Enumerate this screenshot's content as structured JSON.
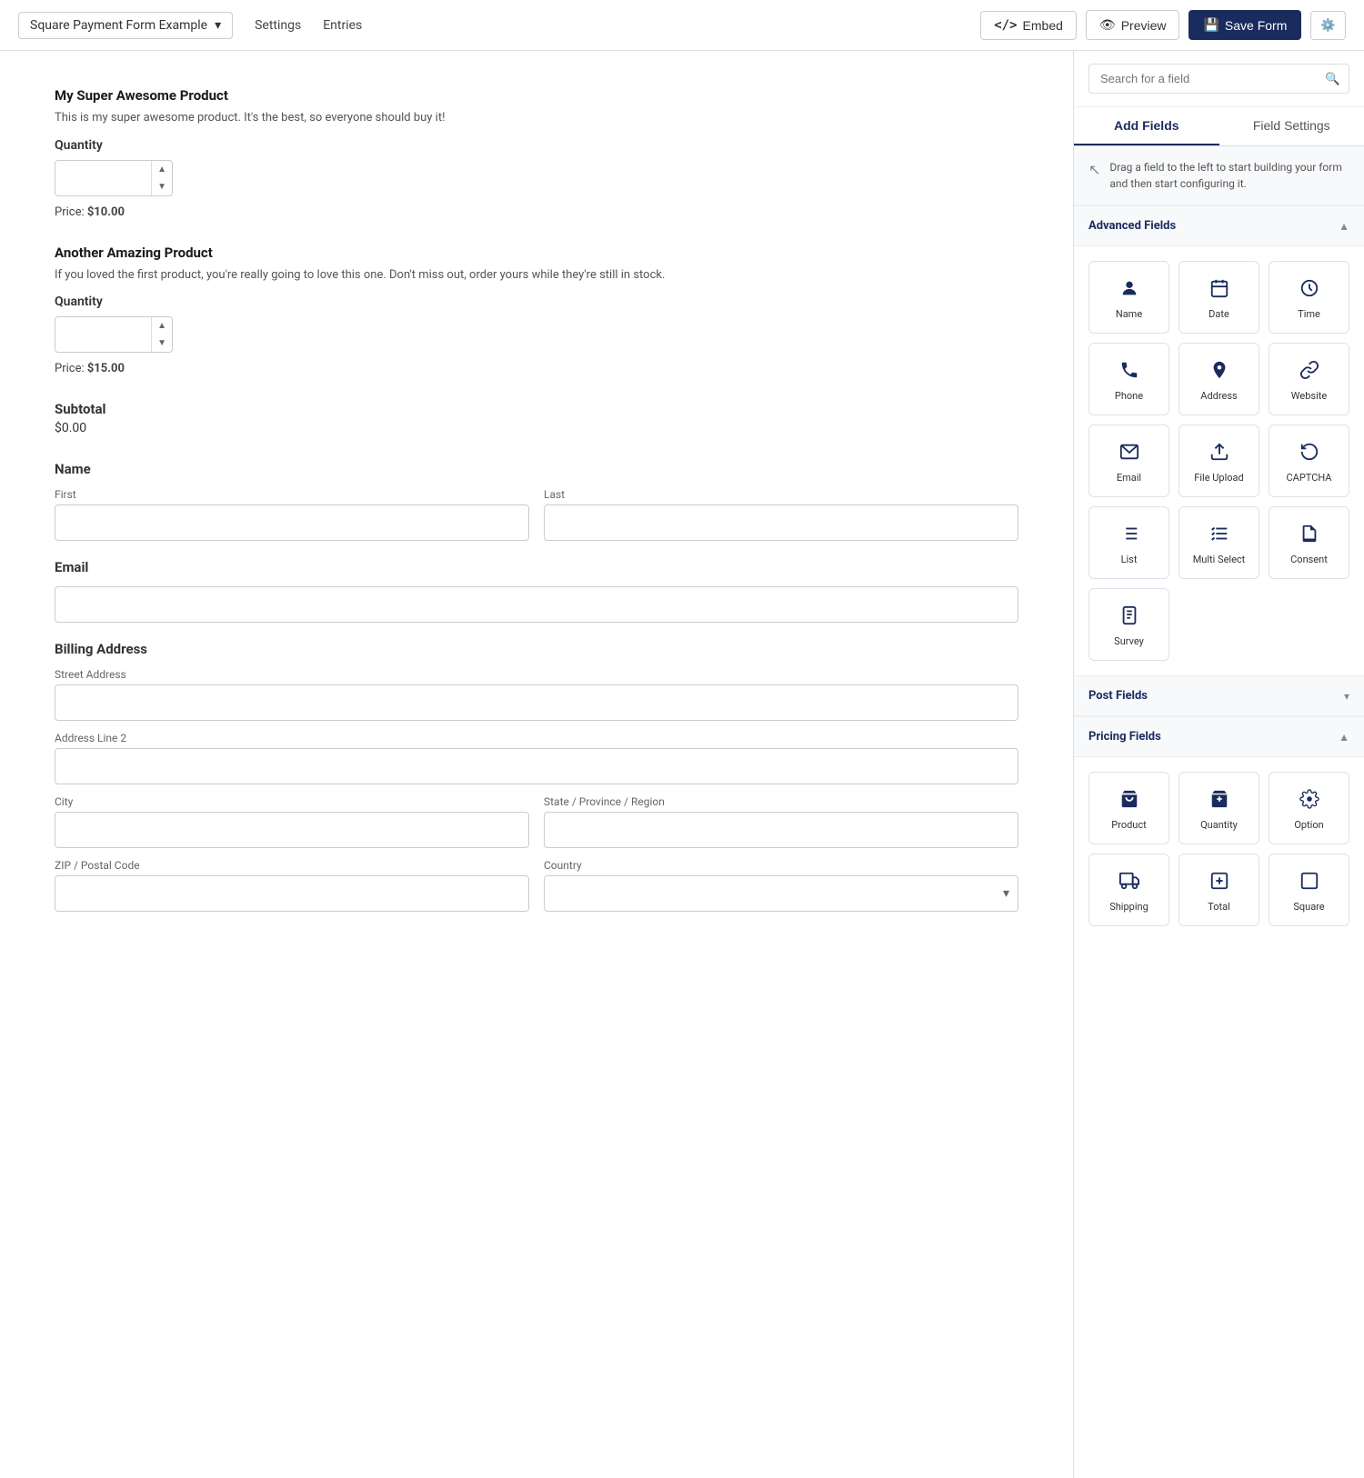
{
  "topNav": {
    "formSelector": "Square Payment Form Example",
    "settingsLink": "Settings",
    "entriesLink": "Entries",
    "embedLabel": "Embed",
    "previewLabel": "Preview",
    "saveLabel": "Save Form"
  },
  "formArea": {
    "product1": {
      "name": "My Super Awesome Product",
      "description": "This is my super awesome product. It's the best, so everyone should buy it!",
      "quantityLabel": "Quantity",
      "price": "$10.00"
    },
    "product2": {
      "name": "Another Amazing Product",
      "description": "If you loved the first product, you're really going to love this one. Don't miss out, order yours while they're still in stock.",
      "quantityLabel": "Quantity",
      "price": "$15.00"
    },
    "subtotal": {
      "title": "Subtotal",
      "value": "$0.00"
    },
    "nameSection": {
      "label": "Name",
      "firstLabel": "First",
      "lastLabel": "Last",
      "firstPlaceholder": "",
      "lastPlaceholder": ""
    },
    "emailSection": {
      "label": "Email",
      "placeholder": ""
    },
    "billingSection": {
      "label": "Billing Address",
      "streetLabel": "Street Address",
      "addressLine2Label": "Address Line 2",
      "cityLabel": "City",
      "stateLabel": "State / Province / Region",
      "zipLabel": "ZIP / Postal Code",
      "countryLabel": "Country",
      "countryPlaceholder": ""
    }
  },
  "rightPanel": {
    "searchPlaceholder": "Search for a field",
    "tabs": {
      "addFields": "Add Fields",
      "fieldSettings": "Field Settings"
    },
    "dragHint": "Drag a field to the left to start building your form and then start configuring it.",
    "advancedFields": {
      "title": "Advanced Fields",
      "fields": [
        {
          "label": "Name",
          "icon": "👤"
        },
        {
          "label": "Date",
          "icon": "📅"
        },
        {
          "label": "Time",
          "icon": "🕐"
        },
        {
          "label": "Phone",
          "icon": "📞"
        },
        {
          "label": "Address",
          "icon": "📍"
        },
        {
          "label": "Website",
          "icon": "🔗"
        },
        {
          "label": "Email",
          "icon": "✉️"
        },
        {
          "label": "File Upload",
          "icon": "⬆"
        },
        {
          "label": "CAPTCHA",
          "icon": "🔄"
        },
        {
          "label": "List",
          "icon": "☰"
        },
        {
          "label": "Multi Select",
          "icon": "☰"
        },
        {
          "label": "Consent",
          "icon": "📄"
        },
        {
          "label": "Survey",
          "icon": "📋"
        }
      ]
    },
    "postFields": {
      "title": "Post Fields"
    },
    "pricingFields": {
      "title": "Pricing Fields",
      "fields": [
        {
          "label": "Product",
          "icon": "🛒"
        },
        {
          "label": "Quantity",
          "icon": "🛒"
        },
        {
          "label": "Option",
          "icon": "⚙"
        },
        {
          "label": "Shipping",
          "icon": "🚚"
        },
        {
          "label": "Total",
          "icon": "💲"
        },
        {
          "label": "Square",
          "icon": "⬜"
        }
      ]
    }
  }
}
